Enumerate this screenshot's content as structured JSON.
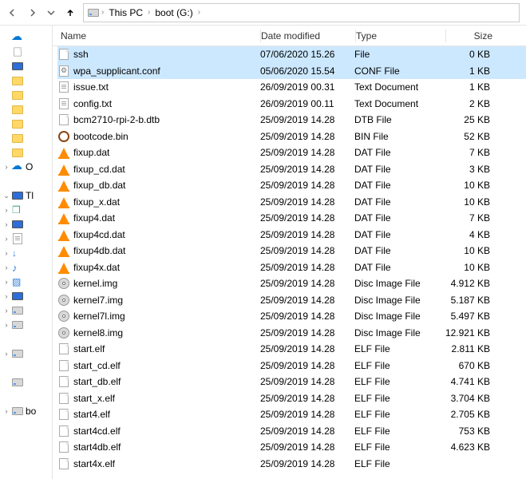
{
  "nav": {
    "back_enabled": false,
    "fwd_enabled": false,
    "up_enabled": true
  },
  "breadcrumbs": [
    "This PC",
    "boot (G:)"
  ],
  "sidebar": [
    {
      "tw": "",
      "icon": "onedrive",
      "label": ""
    },
    {
      "tw": "",
      "icon": "blank-small",
      "label": ""
    },
    {
      "tw": "",
      "icon": "monitor",
      "label": ""
    },
    {
      "tw": "",
      "icon": "folder",
      "label": ""
    },
    {
      "tw": "",
      "icon": "folder",
      "label": ""
    },
    {
      "tw": "",
      "icon": "folder",
      "label": ""
    },
    {
      "tw": "",
      "icon": "folder",
      "label": ""
    },
    {
      "tw": "",
      "icon": "folder",
      "label": ""
    },
    {
      "tw": "",
      "icon": "folder",
      "label": ""
    },
    {
      "tw": "right",
      "icon": "onedrive",
      "label": "O"
    },
    {
      "tw": "",
      "icon": "spacer",
      "label": ""
    },
    {
      "tw": "down",
      "icon": "monitor",
      "label": "Tl"
    },
    {
      "tw": "right",
      "icon": "obj",
      "label": ""
    },
    {
      "tw": "right",
      "icon": "monitor",
      "label": ""
    },
    {
      "tw": "right",
      "icon": "text",
      "label": ""
    },
    {
      "tw": "right",
      "icon": "dl",
      "label": ""
    },
    {
      "tw": "right",
      "icon": "music",
      "label": ""
    },
    {
      "tw": "right",
      "icon": "pic",
      "label": ""
    },
    {
      "tw": "right",
      "icon": "monitor",
      "label": ""
    },
    {
      "tw": "right",
      "icon": "drive",
      "label": ""
    },
    {
      "tw": "right",
      "icon": "drive",
      "label": ""
    },
    {
      "tw": "",
      "icon": "spacer",
      "label": ""
    },
    {
      "tw": "right",
      "icon": "drive",
      "label": ""
    },
    {
      "tw": "",
      "icon": "spacer",
      "label": ""
    },
    {
      "tw": "",
      "icon": "drive",
      "label": ""
    },
    {
      "tw": "",
      "icon": "spacer",
      "label": ""
    },
    {
      "tw": "right",
      "icon": "drive",
      "label": "bo"
    }
  ],
  "columns": {
    "name": "Name",
    "date": "Date modified",
    "type": "Type",
    "size": "Size"
  },
  "files": [
    {
      "sel": true,
      "icon": "blank",
      "name": "ssh",
      "date": "07/06/2020 15.26",
      "type": "File",
      "size": "0 KB"
    },
    {
      "sel": true,
      "icon": "ini",
      "name": "wpa_supplicant.conf",
      "date": "05/06/2020 15.54",
      "type": "CONF File",
      "size": "1 KB"
    },
    {
      "sel": false,
      "icon": "text",
      "name": "issue.txt",
      "date": "26/09/2019 00.31",
      "type": "Text Document",
      "size": "1 KB"
    },
    {
      "sel": false,
      "icon": "text",
      "name": "config.txt",
      "date": "26/09/2019 00.11",
      "type": "Text Document",
      "size": "2 KB"
    },
    {
      "sel": false,
      "icon": "blank",
      "name": "bcm2710-rpi-2-b.dtb",
      "date": "25/09/2019 14.28",
      "type": "DTB File",
      "size": "25 KB"
    },
    {
      "sel": false,
      "icon": "ring",
      "name": "bootcode.bin",
      "date": "25/09/2019 14.28",
      "type": "BIN File",
      "size": "52 KB"
    },
    {
      "sel": false,
      "icon": "vlc",
      "name": "fixup.dat",
      "date": "25/09/2019 14.28",
      "type": "DAT File",
      "size": "7 KB"
    },
    {
      "sel": false,
      "icon": "vlc",
      "name": "fixup_cd.dat",
      "date": "25/09/2019 14.28",
      "type": "DAT File",
      "size": "3 KB"
    },
    {
      "sel": false,
      "icon": "vlc",
      "name": "fixup_db.dat",
      "date": "25/09/2019 14.28",
      "type": "DAT File",
      "size": "10 KB"
    },
    {
      "sel": false,
      "icon": "vlc",
      "name": "fixup_x.dat",
      "date": "25/09/2019 14.28",
      "type": "DAT File",
      "size": "10 KB"
    },
    {
      "sel": false,
      "icon": "vlc",
      "name": "fixup4.dat",
      "date": "25/09/2019 14.28",
      "type": "DAT File",
      "size": "7 KB"
    },
    {
      "sel": false,
      "icon": "vlc",
      "name": "fixup4cd.dat",
      "date": "25/09/2019 14.28",
      "type": "DAT File",
      "size": "4 KB"
    },
    {
      "sel": false,
      "icon": "vlc",
      "name": "fixup4db.dat",
      "date": "25/09/2019 14.28",
      "type": "DAT File",
      "size": "10 KB"
    },
    {
      "sel": false,
      "icon": "vlc",
      "name": "fixup4x.dat",
      "date": "25/09/2019 14.28",
      "type": "DAT File",
      "size": "10 KB"
    },
    {
      "sel": false,
      "icon": "disc",
      "name": "kernel.img",
      "date": "25/09/2019 14.28",
      "type": "Disc Image File",
      "size": "4.912 KB"
    },
    {
      "sel": false,
      "icon": "disc",
      "name": "kernel7.img",
      "date": "25/09/2019 14.28",
      "type": "Disc Image File",
      "size": "5.187 KB"
    },
    {
      "sel": false,
      "icon": "disc",
      "name": "kernel7l.img",
      "date": "25/09/2019 14.28",
      "type": "Disc Image File",
      "size": "5.497 KB"
    },
    {
      "sel": false,
      "icon": "disc",
      "name": "kernel8.img",
      "date": "25/09/2019 14.28",
      "type": "Disc Image File",
      "size": "12.921 KB"
    },
    {
      "sel": false,
      "icon": "blank",
      "name": "start.elf",
      "date": "25/09/2019 14.28",
      "type": "ELF File",
      "size": "2.811 KB"
    },
    {
      "sel": false,
      "icon": "blank",
      "name": "start_cd.elf",
      "date": "25/09/2019 14.28",
      "type": "ELF File",
      "size": "670 KB"
    },
    {
      "sel": false,
      "icon": "blank",
      "name": "start_db.elf",
      "date": "25/09/2019 14.28",
      "type": "ELF File",
      "size": "4.741 KB"
    },
    {
      "sel": false,
      "icon": "blank",
      "name": "start_x.elf",
      "date": "25/09/2019 14.28",
      "type": "ELF File",
      "size": "3.704 KB"
    },
    {
      "sel": false,
      "icon": "blank",
      "name": "start4.elf",
      "date": "25/09/2019 14.28",
      "type": "ELF File",
      "size": "2.705 KB"
    },
    {
      "sel": false,
      "icon": "blank",
      "name": "start4cd.elf",
      "date": "25/09/2019 14.28",
      "type": "ELF File",
      "size": "753 KB"
    },
    {
      "sel": false,
      "icon": "blank",
      "name": "start4db.elf",
      "date": "25/09/2019 14.28",
      "type": "ELF File",
      "size": "4.623 KB"
    },
    {
      "sel": false,
      "icon": "blank",
      "name": "start4x.elf",
      "date": "25/09/2019 14.28",
      "type": "ELF File",
      "size": ""
    }
  ]
}
